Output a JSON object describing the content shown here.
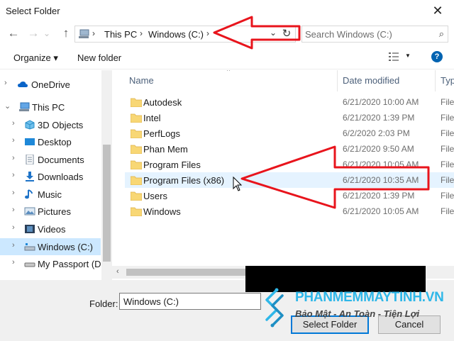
{
  "window": {
    "title": "Select Folder",
    "close_glyph": "✕"
  },
  "nav": {
    "back_glyph": "←",
    "forward_glyph": "→",
    "recent_glyph": "⌄",
    "up_glyph": "↑",
    "breadcrumbs": [
      "This PC",
      "Windows (C:)"
    ],
    "crumb_sep": "›",
    "dropdown_glyph": "⌄",
    "refresh_glyph": "↻",
    "search_placeholder": "Search Windows (C:)",
    "search_glyph": "⌕"
  },
  "toolbar": {
    "organize_label": "Organize ▾",
    "new_folder_label": "New folder",
    "view_dropdown_glyph": "▼",
    "help_label": "?"
  },
  "sidebar": {
    "items": [
      {
        "label": "OneDrive",
        "chevron": "›",
        "icon": "cloud-icon"
      },
      {
        "label": "This PC",
        "chevron": "⌄",
        "icon": "computer-icon"
      },
      {
        "label": "3D Objects",
        "chevron": "›",
        "icon": "cube-icon"
      },
      {
        "label": "Desktop",
        "chevron": "›",
        "icon": "desktop-icon"
      },
      {
        "label": "Documents",
        "chevron": "›",
        "icon": "document-icon"
      },
      {
        "label": "Downloads",
        "chevron": "›",
        "icon": "download-icon"
      },
      {
        "label": "Music",
        "chevron": "›",
        "icon": "music-icon"
      },
      {
        "label": "Pictures",
        "chevron": "›",
        "icon": "picture-icon"
      },
      {
        "label": "Videos",
        "chevron": "›",
        "icon": "video-icon"
      },
      {
        "label": "Windows (C:)",
        "chevron": "›",
        "icon": "drive-icon",
        "selected": true
      },
      {
        "label": "My Passport (D:)",
        "chevron": "›",
        "icon": "external-drive-icon"
      }
    ]
  },
  "files": {
    "columns": [
      "Name",
      "Date modified",
      "Typ"
    ],
    "sort_caret": "^",
    "rows": [
      {
        "name": "Autodesk",
        "date": "6/21/2020 10:00 AM",
        "type": "File"
      },
      {
        "name": "Intel",
        "date": "6/21/2020 1:39 PM",
        "type": "File"
      },
      {
        "name": "PerfLogs",
        "date": "6/2/2020 2:03 PM",
        "type": "File"
      },
      {
        "name": "Phan Mem",
        "date": "6/21/2020 9:50 AM",
        "type": "File"
      },
      {
        "name": "Program Files",
        "date": "6/21/2020 10:05 AM",
        "type": "File"
      },
      {
        "name": "Program Files (x86)",
        "date": "6/21/2020 10:35 AM",
        "type": "File",
        "hover": true
      },
      {
        "name": "Users",
        "date": "6/21/2020 1:39 PM",
        "type": "File"
      },
      {
        "name": "Windows",
        "date": "6/21/2020 10:05 AM",
        "type": "File"
      }
    ],
    "scroll_left_glyph": "‹",
    "scroll_right_glyph": "›"
  },
  "footer": {
    "folder_label": "Folder:",
    "folder_value": "Windows (C:)",
    "select_button": "Select Folder",
    "cancel_button": "Cancel"
  },
  "watermark": {
    "site": "PHANMEMMAYTINH.VN",
    "tagline": "Bảo Mật - An Toàn - Tiện Lợi"
  },
  "colors": {
    "selection": "#cce8ff",
    "hover": "#e5f3ff",
    "folder": "#f8d775",
    "annotation": "#e8141c",
    "accent": "#0078d7"
  }
}
